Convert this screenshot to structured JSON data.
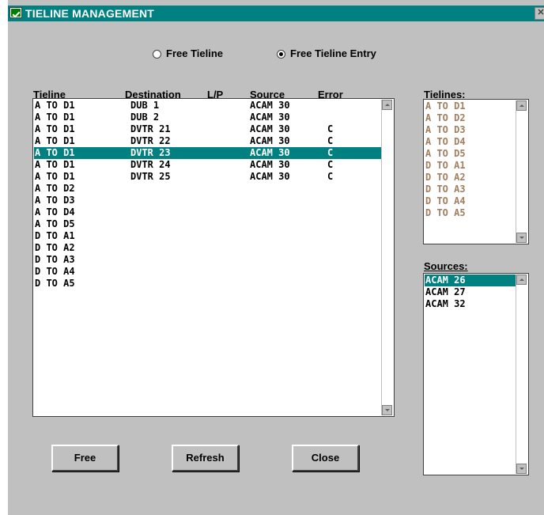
{
  "window": {
    "title": "TIELINE MANAGEMENT"
  },
  "modes": [
    {
      "label": "Free Tieline",
      "checked": false
    },
    {
      "label": "Free Tieline Entry",
      "checked": true
    }
  ],
  "main_list": {
    "headers": {
      "tieline": "Tieline",
      "destination": "Destination",
      "lp": "L/P",
      "source": "Source",
      "error": "Error"
    },
    "rows": [
      {
        "tieline": "A TO D1",
        "destination": "DUB 1",
        "lp": "",
        "source": "ACAM 30",
        "error": ""
      },
      {
        "tieline": "A TO D1",
        "destination": "DUB 2",
        "lp": "",
        "source": "ACAM 30",
        "error": ""
      },
      {
        "tieline": "A TO D1",
        "destination": "DVTR 21",
        "lp": "",
        "source": "ACAM 30",
        "error": "C"
      },
      {
        "tieline": "A TO D1",
        "destination": "DVTR 22",
        "lp": "",
        "source": "ACAM 30",
        "error": "C"
      },
      {
        "tieline": "A TO D1",
        "destination": "DVTR 23",
        "lp": "",
        "source": "ACAM 30",
        "error": "C"
      },
      {
        "tieline": "A TO D1",
        "destination": "DVTR 24",
        "lp": "",
        "source": "ACAM 30",
        "error": "C"
      },
      {
        "tieline": "A TO D1",
        "destination": "DVTR 25",
        "lp": "",
        "source": "ACAM 30",
        "error": "C"
      },
      {
        "tieline": "A TO D2",
        "destination": "",
        "lp": "",
        "source": "",
        "error": ""
      },
      {
        "tieline": "A TO D3",
        "destination": "",
        "lp": "",
        "source": "",
        "error": ""
      },
      {
        "tieline": "A TO D4",
        "destination": "",
        "lp": "",
        "source": "",
        "error": ""
      },
      {
        "tieline": "A TO D5",
        "destination": "",
        "lp": "",
        "source": "",
        "error": ""
      },
      {
        "tieline": "D TO A1",
        "destination": "",
        "lp": "",
        "source": "",
        "error": ""
      },
      {
        "tieline": "D TO A2",
        "destination": "",
        "lp": "",
        "source": "",
        "error": ""
      },
      {
        "tieline": "D TO A3",
        "destination": "",
        "lp": "",
        "source": "",
        "error": ""
      },
      {
        "tieline": "D TO A4",
        "destination": "",
        "lp": "",
        "source": "",
        "error": ""
      },
      {
        "tieline": "D TO A5",
        "destination": "",
        "lp": "",
        "source": "",
        "error": ""
      }
    ],
    "selected_index": 4
  },
  "tielines_panel": {
    "label": "Tielines:",
    "items": [
      "A TO D1",
      "A TO D2",
      "A TO D3",
      "A TO D4",
      "A TO D5",
      "D TO A1",
      "D TO A2",
      "D TO A3",
      "D TO A4",
      "D TO A5"
    ]
  },
  "sources_panel": {
    "label": "Sources:",
    "items": [
      "ACAM 26",
      "ACAM 27",
      "ACAM 32"
    ],
    "selected_index": 0
  },
  "buttons": {
    "free": "Free",
    "refresh": "Refresh",
    "close": "Close"
  },
  "colors": {
    "title_bar": "#008080",
    "selection": "#008080",
    "disabled_text": "#a08060",
    "window_bg": "#c0c0c0"
  }
}
